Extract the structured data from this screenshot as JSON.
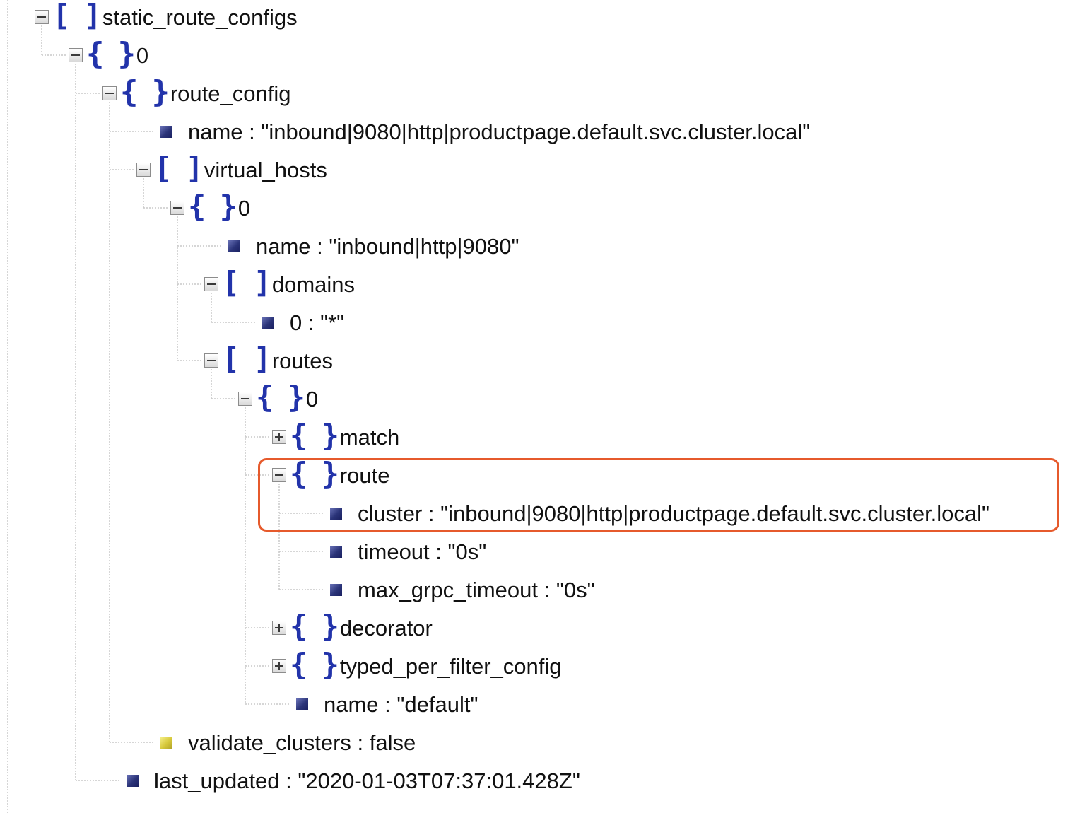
{
  "tree": [
    {
      "depth": 0,
      "kind": "array",
      "expanded": true,
      "label": "static_route_configs"
    },
    {
      "depth": 1,
      "kind": "object",
      "expanded": true,
      "label": "0"
    },
    {
      "depth": 2,
      "kind": "object",
      "expanded": true,
      "label": "route_config"
    },
    {
      "depth": 3,
      "kind": "value",
      "label": "name : \"inbound|9080|http|productpage.default.svc.cluster.local\""
    },
    {
      "depth": 3,
      "kind": "array",
      "expanded": true,
      "label": "virtual_hosts"
    },
    {
      "depth": 4,
      "kind": "object",
      "expanded": true,
      "label": "0"
    },
    {
      "depth": 5,
      "kind": "value",
      "label": "name : \"inbound|http|9080\""
    },
    {
      "depth": 5,
      "kind": "array",
      "expanded": true,
      "label": "domains"
    },
    {
      "depth": 6,
      "kind": "value",
      "label": "0 : \"*\""
    },
    {
      "depth": 5,
      "kind": "array",
      "expanded": true,
      "label": "routes"
    },
    {
      "depth": 6,
      "kind": "object",
      "expanded": true,
      "label": "0"
    },
    {
      "depth": 7,
      "kind": "object",
      "expanded": false,
      "label": "match"
    },
    {
      "depth": 7,
      "kind": "object",
      "expanded": true,
      "label": "route",
      "highlighted": true
    },
    {
      "depth": 8,
      "kind": "value",
      "label": "cluster : \"inbound|9080|http|productpage.default.svc.cluster.local\"",
      "highlighted": true
    },
    {
      "depth": 8,
      "kind": "value",
      "label": "timeout : \"0s\""
    },
    {
      "depth": 8,
      "kind": "value",
      "label": "max_grpc_timeout : \"0s\""
    },
    {
      "depth": 7,
      "kind": "object",
      "expanded": false,
      "label": "decorator"
    },
    {
      "depth": 7,
      "kind": "object",
      "expanded": false,
      "label": "typed_per_filter_config"
    },
    {
      "depth": 7,
      "kind": "value",
      "label": "name : \"default\""
    },
    {
      "depth": 3,
      "kind": "value",
      "value_type": "boolean",
      "label": "validate_clusters : false"
    },
    {
      "depth": 2,
      "kind": "value",
      "label": "last_updated : \"2020-01-03T07:37:01.428Z\""
    }
  ],
  "colors": {
    "bracket": "#2233aa",
    "value_bullet": "#2a3378",
    "boolean_bullet": "#d6c83a",
    "highlight_border": "#e65a2c",
    "guide_line": "#c8c8c8"
  },
  "icons": {
    "expand_toggle": "minus-box-icon",
    "collapse_toggle": "plus-box-icon",
    "array": "square-brackets-icon",
    "object": "curly-braces-icon",
    "value": "square-bullet-icon"
  }
}
